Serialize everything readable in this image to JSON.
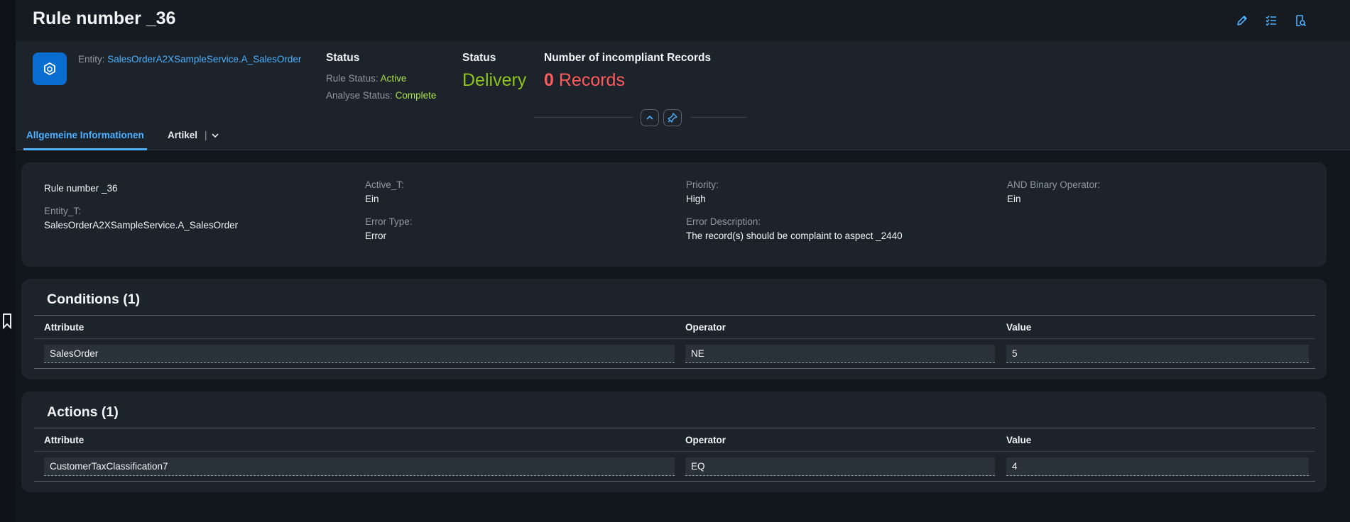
{
  "title": "Rule number _36",
  "header": {
    "entity_label": "Entity:",
    "entity_value": "SalesOrderA2XSampleService.A_SalesOrder",
    "status_block": {
      "title": "Status",
      "rule_status_label": "Rule Status:",
      "rule_status_value": "Active",
      "analyse_status_label": "Analyse Status:",
      "analyse_status_value": "Complete"
    },
    "status2": {
      "title": "Status",
      "value": "Delivery"
    },
    "incompliant": {
      "title": "Number of incompliant Records",
      "count": "0",
      "unit": "Records"
    }
  },
  "tabs": [
    {
      "label": "Allgemeine Informationen"
    },
    {
      "label": "Artikel"
    }
  ],
  "general": {
    "name": "Rule number _36",
    "entity_label": "Entity_T:",
    "entity_value": "SalesOrderA2XSampleService.A_SalesOrder",
    "active_label": "Active_T:",
    "active_value": "Ein",
    "error_type_label": "Error Type:",
    "error_type_value": "Error",
    "priority_label": "Priority:",
    "priority_value": "High",
    "error_desc_label": "Error Description:",
    "error_desc_value": "The record(s) should be complaint to aspect _2440",
    "and_label": "AND Binary Operator:",
    "and_value": "Ein"
  },
  "conditions": {
    "title": "Conditions (1)",
    "columns": [
      "Attribute",
      "Operator",
      "Value"
    ],
    "rows": [
      {
        "attribute": "SalesOrder",
        "operator": "NE",
        "value": "5"
      }
    ]
  },
  "actions": {
    "title": "Actions (1)",
    "columns": [
      "Attribute",
      "Operator",
      "Value"
    ],
    "rows": [
      {
        "attribute": "CustomerTaxClassification7",
        "operator": "EQ",
        "value": "4"
      }
    ]
  },
  "icons": {
    "edit": "pencil-icon",
    "checklist": "checklist-icon",
    "inspect": "document-search-icon",
    "avatar": "cube-icon",
    "collapse": "chevron-up-icon",
    "pin": "pin-icon",
    "bookmark": "bookmark-icon",
    "tab_menu": "chevron-down-icon"
  },
  "colors": {
    "accent": "#4db1ff",
    "positive": "#8fc31f",
    "negative": "#ff5a5a",
    "avatar_bg": "#0a6ed1"
  }
}
